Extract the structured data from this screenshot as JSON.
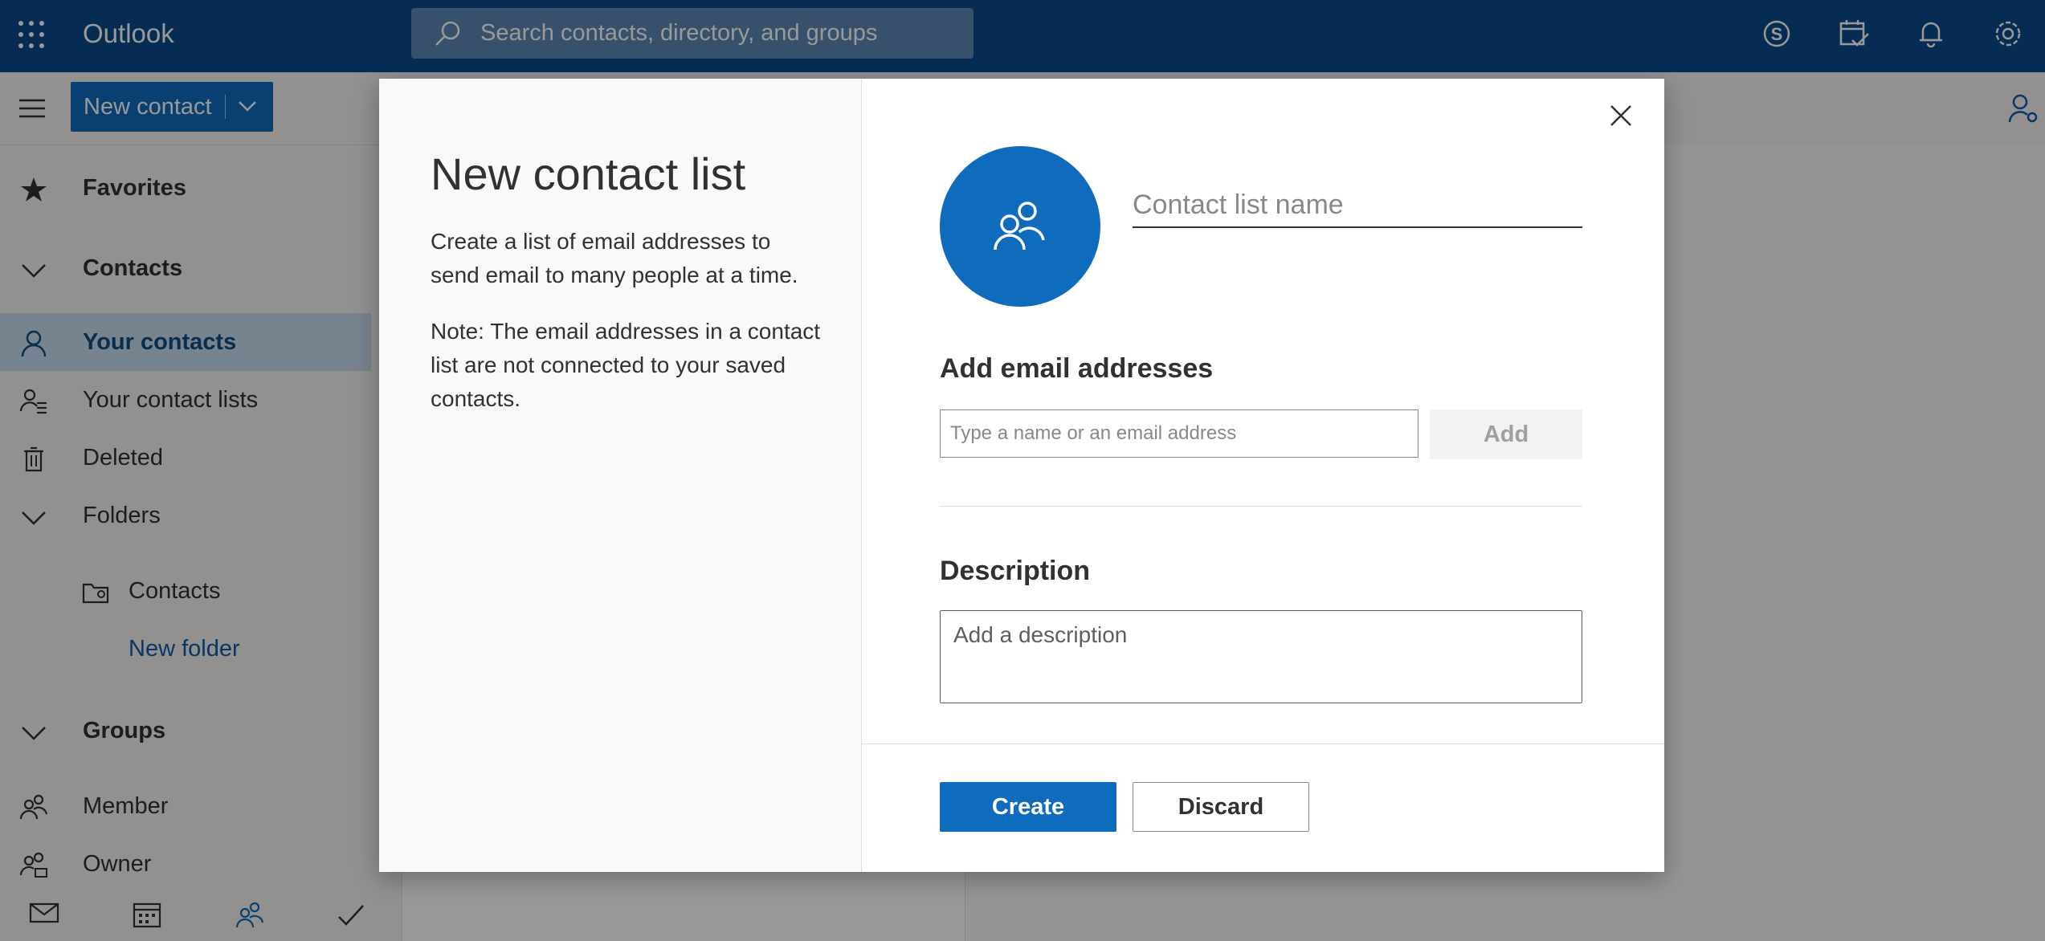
{
  "app": {
    "title": "Outlook"
  },
  "header": {
    "search_placeholder": "Search contacts, directory, and groups",
    "icons": [
      "skype-icon",
      "my-day-icon",
      "bell-icon",
      "gear-icon"
    ]
  },
  "toolbar": {
    "new_contact_label": "New contact"
  },
  "sidebar": {
    "favorites": "Favorites",
    "contacts_group": "Contacts",
    "your_contacts": "Your contacts",
    "your_contact_lists": "Your contact lists",
    "deleted": "Deleted",
    "folders": "Folders",
    "folder_contacts": "Contacts",
    "new_folder": "New folder",
    "groups": "Groups",
    "member": "Member",
    "owner": "Owner"
  },
  "bottom_nav": [
    "mail-icon",
    "calendar-icon",
    "people-icon",
    "todo-icon"
  ],
  "colors": {
    "brand": "#0b4a8a",
    "accent": "#0f6cbd"
  },
  "dialog": {
    "title": "New contact list",
    "description_1": "Create a list of email addresses to send email to many people at a time.",
    "description_2": "Note: The email addresses in a contact list are not connected to your saved contacts.",
    "name_placeholder": "Contact list name",
    "add_email_heading": "Add email addresses",
    "email_placeholder": "Type a name or an email address",
    "add_label": "Add",
    "description_heading": "Description",
    "description_placeholder": "Add a description",
    "create_label": "Create",
    "discard_label": "Discard"
  }
}
